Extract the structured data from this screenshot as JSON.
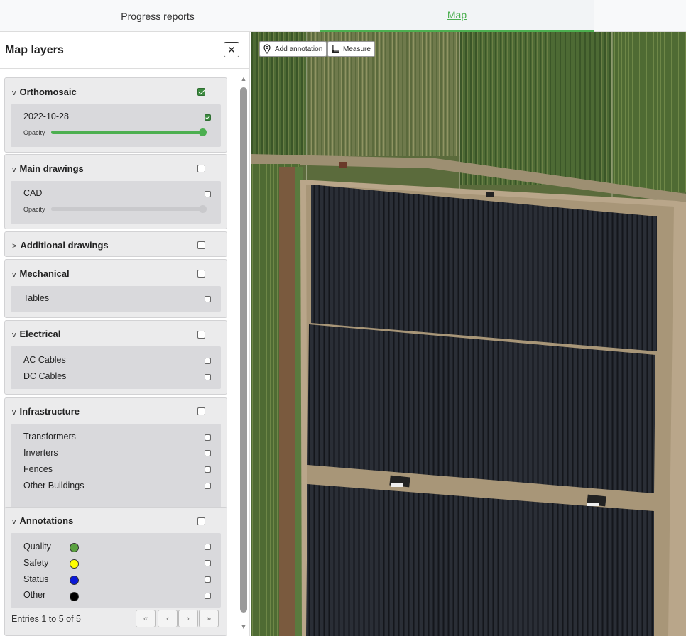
{
  "tabs": [
    {
      "label": "Progress reports",
      "active": false
    },
    {
      "label": "Map",
      "active": true
    }
  ],
  "colors": {
    "accent": "#4caf50",
    "quality": "#5aa140",
    "safety": "#ffff00",
    "status": "#0b19d8",
    "other": "#000000"
  },
  "sidebar": {
    "title": "Map layers",
    "groups": [
      {
        "title": "Orthomosaic",
        "expanded": true,
        "checked": true,
        "items": [
          {
            "label": "2022-10-28",
            "checked": true,
            "opacity_label": "Opacity",
            "opacity": 1.0,
            "enabled": true
          }
        ]
      },
      {
        "title": "Main drawings",
        "expanded": true,
        "checked": false,
        "items": [
          {
            "label": "CAD",
            "checked": false,
            "opacity_label": "Opacity",
            "opacity": 1.0,
            "enabled": false
          }
        ]
      },
      {
        "title": "Additional drawings",
        "expanded": false,
        "checked": false,
        "items": []
      },
      {
        "title": "Mechanical",
        "expanded": true,
        "checked": false,
        "items": [
          {
            "label": "Tables",
            "checked": false
          }
        ]
      },
      {
        "title": "Electrical",
        "expanded": true,
        "checked": false,
        "items": [
          {
            "label": "AC Cables",
            "checked": false
          },
          {
            "label": "DC Cables",
            "checked": false
          }
        ]
      },
      {
        "title": "Infrastructure",
        "expanded": true,
        "checked": false,
        "items": [
          {
            "label": "Transformers",
            "checked": false
          },
          {
            "label": "Inverters",
            "checked": false
          },
          {
            "label": "Fences",
            "checked": false
          },
          {
            "label": "Other Buildings",
            "checked": false
          }
        ]
      },
      {
        "title": "Annotations",
        "expanded": true,
        "checked": false,
        "items": [
          {
            "label": "Quality",
            "checked": false
          },
          {
            "label": "Safety",
            "checked": false
          },
          {
            "label": "Status",
            "checked": false
          },
          {
            "label": "Other",
            "checked": false
          }
        ]
      }
    ],
    "chevron_expanded": "v",
    "chevron_collapsed": ">",
    "entries_text": "Entries 1 to 5 of 5",
    "pagination": {
      "first": "«",
      "prev": "‹",
      "next": "›",
      "last": "»"
    }
  },
  "map": {
    "tools": [
      {
        "label": "Add annotation",
        "icon": "map-pin-icon"
      },
      {
        "label": "Measure",
        "icon": "ruler-icon"
      }
    ]
  }
}
